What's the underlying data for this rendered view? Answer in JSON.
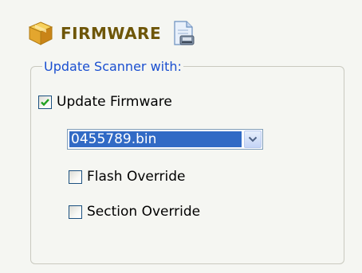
{
  "header": {
    "title": "FIRMWARE",
    "title_color": "#6e5608",
    "icon": "box-icon",
    "action_icon": "document-icon"
  },
  "group": {
    "legend": "Update Scanner with:",
    "legend_color": "#1a4fd0"
  },
  "update_firmware": {
    "label": "Update Firmware",
    "checked": true
  },
  "firmware_select": {
    "value": "0455789.bin",
    "icon": "chevron-down-icon"
  },
  "flash_override": {
    "label": "Flash Override",
    "checked": false
  },
  "section_override": {
    "label": "Section Override",
    "checked": false
  }
}
